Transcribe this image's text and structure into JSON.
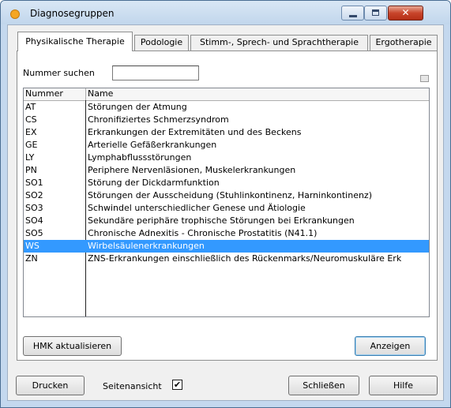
{
  "window": {
    "title": "Diagnosegruppen",
    "controls": {
      "minimize": "minimize-icon",
      "maximize": "maximize-icon",
      "close": "✕"
    }
  },
  "tabs": [
    {
      "label": "Physikalische Therapie",
      "active": true
    },
    {
      "label": "Podologie"
    },
    {
      "label": "Stimm-, Sprech- und Sprachtherapie"
    },
    {
      "label": "Ergotherapie"
    }
  ],
  "search": {
    "label": "Nummer suchen",
    "value": ""
  },
  "table": {
    "columns": [
      "Nummer",
      "Name"
    ],
    "rows": [
      {
        "code": "AT",
        "name": "Störungen der Atmung"
      },
      {
        "code": "CS",
        "name": "Chronifiziertes Schmerzsyndrom"
      },
      {
        "code": "EX",
        "name": "Erkrankungen der Extremitäten und des Beckens"
      },
      {
        "code": "GE",
        "name": "Arterielle Gefäßerkrankungen"
      },
      {
        "code": "LY",
        "name": "Lymphabflussstörungen"
      },
      {
        "code": "PN",
        "name": "Periphere Nervenläsionen, Muskelerkrankungen"
      },
      {
        "code": "SO1",
        "name": "Störung der Dickdarmfunktion"
      },
      {
        "code": "SO2",
        "name": "Störungen der Ausscheidung (Stuhlinkontinenz, Harninkontinenz)"
      },
      {
        "code": "SO3",
        "name": "Schwindel unterschiedlicher Genese und Ätiologie"
      },
      {
        "code": "SO4",
        "name": "Sekundäre periphäre trophische Störungen bei Erkrankungen"
      },
      {
        "code": "SO5",
        "name": "Chronische Adnexitis - Chronische Prostatitis (N41.1)"
      },
      {
        "code": "WS",
        "name": "Wirbelsäulenerkrankungen",
        "selected": true
      },
      {
        "code": "ZN",
        "name": "ZNS-Erkrankungen einschließlich des Rückenmarks/Neuromuskuläre Erk"
      }
    ]
  },
  "buttons": {
    "hmk_update": "HMK aktualisieren",
    "show": "Anzeigen",
    "print": "Drucken",
    "close": "Schließen",
    "help": "Hilfe"
  },
  "page_preview": {
    "label": "Seitenansicht",
    "checked": true,
    "mark": "✔"
  },
  "colors": {
    "selection": "#3399ff",
    "titlebar": "#c4d8ee",
    "close_button": "#c8452b"
  }
}
